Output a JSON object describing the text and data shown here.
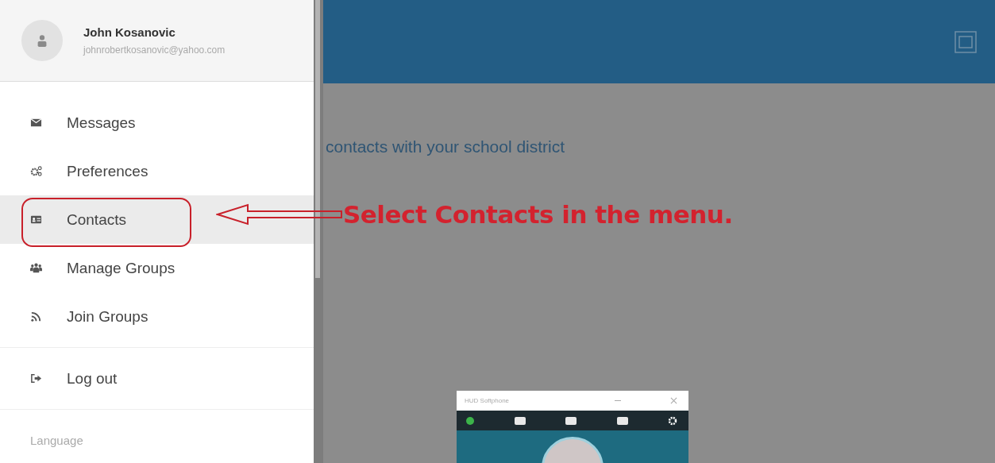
{
  "user": {
    "name": "John Kosanovic",
    "email": "johnrobertkosanovic@yahoo.com"
  },
  "menu": [
    {
      "label": "Messages",
      "kind": "envelope",
      "selected": false
    },
    {
      "label": "Preferences",
      "kind": "gears",
      "selected": false
    },
    {
      "label": "Contacts",
      "kind": "card",
      "selected": true
    },
    {
      "label": "Manage Groups",
      "kind": "people",
      "selected": false
    },
    {
      "label": "Join Groups",
      "kind": "feed",
      "selected": false
    }
  ],
  "logout": {
    "label": "Log out"
  },
  "language": {
    "label": "Language"
  },
  "main": {
    "text": "contacts with your school district"
  },
  "annotation": {
    "text": "Select Contacts in the menu."
  },
  "softphone": {
    "title": "HUD Softphone"
  }
}
